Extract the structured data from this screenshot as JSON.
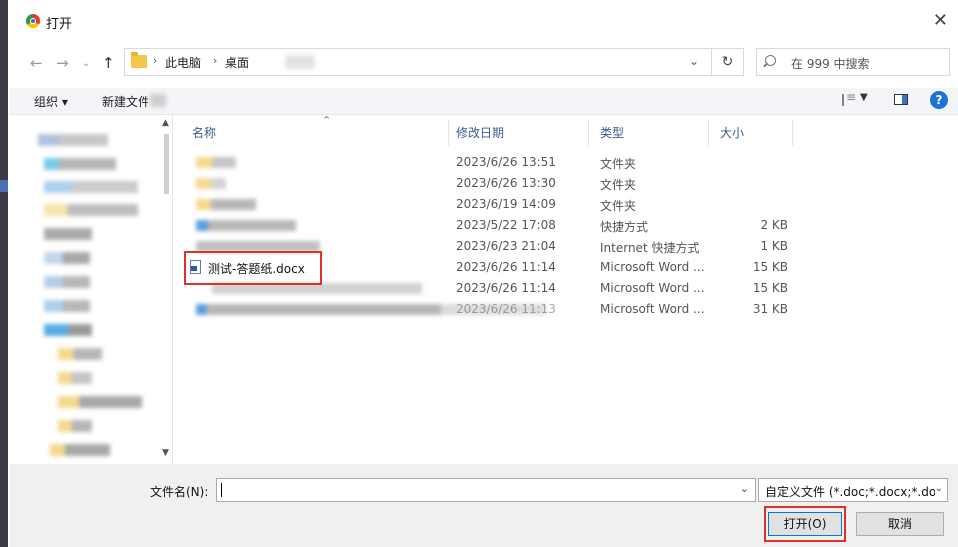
{
  "window": {
    "title": "打开",
    "close_label": "✕"
  },
  "nav": {
    "back": "←",
    "forward": "→",
    "recent": "⌄",
    "up": "↑",
    "breadcrumb": [
      "此电脑",
      "桌面"
    ],
    "address_dropdown": "⌄",
    "refresh": "↻",
    "search_placeholder": "在 999 中搜索"
  },
  "toolbar": {
    "organize": "组织 ▾",
    "new_folder": "新建文件夹"
  },
  "columns": {
    "name": "名称",
    "modified": "修改日期",
    "type": "类型",
    "size": "大小"
  },
  "files": [
    {
      "name": "",
      "modified": "2023/6/26 13:51",
      "type": "文件夹",
      "size": ""
    },
    {
      "name": "",
      "modified": "2023/6/26 13:30",
      "type": "文件夹",
      "size": ""
    },
    {
      "name": "",
      "modified": "2023/6/19 14:09",
      "type": "文件夹",
      "size": ""
    },
    {
      "name": "",
      "modified": "2023/5/22 17:08",
      "type": "快捷方式",
      "size": "2 KB"
    },
    {
      "name": "",
      "modified": "2023/6/23 21:04",
      "type": "Internet 快捷方式",
      "size": "1 KB"
    },
    {
      "name": "测试-答题纸.docx",
      "modified": "2023/6/26 11:14",
      "type": "Microsoft Word ...",
      "size": "15 KB"
    },
    {
      "name": "",
      "modified": "2023/6/26 11:14",
      "type": "Microsoft Word ...",
      "size": "15 KB"
    },
    {
      "name": "",
      "modified": "2023/6/26 11:13",
      "type": "Microsoft Word ...",
      "size": "31 KB"
    }
  ],
  "bottom": {
    "filename_label": "文件名(N):",
    "filename_value": "",
    "filter": "自定义文件 (*.doc;*.docx;*.do",
    "open_label": "打开(O)",
    "cancel_label": "取消"
  },
  "colors": {
    "highlight": "#e0302a",
    "accent": "#0078d7",
    "header_text": "#3a5a8c"
  }
}
